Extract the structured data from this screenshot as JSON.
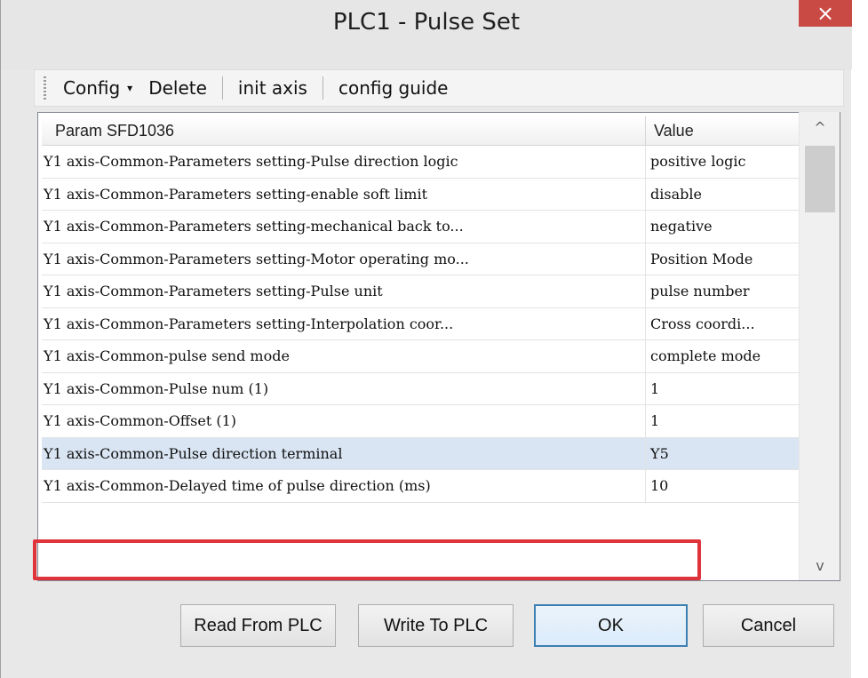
{
  "window": {
    "title": "PLC1 - Pulse  Set",
    "close_glyph": "×"
  },
  "toolbar": {
    "config_label": "Config",
    "config_caret": "▾",
    "delete_label": "Delete",
    "init_axis_label": "init axis",
    "config_guide_label": "config guide"
  },
  "grid": {
    "columns": [
      "Param SFD1036",
      "Value"
    ],
    "rows": [
      {
        "param": "Y1 axis-Common-Parameters setting-Pulse direction logic",
        "value": "positive logic"
      },
      {
        "param": "Y1 axis-Common-Parameters setting-enable soft limit",
        "value": "disable"
      },
      {
        "param": "Y1 axis-Common-Parameters setting-mechanical back to...",
        "value": "negative"
      },
      {
        "param": "Y1 axis-Common-Parameters setting-Motor operating mo...",
        "value": "Position Mode"
      },
      {
        "param": "Y1 axis-Common-Parameters setting-Pulse unit",
        "value": "pulse number"
      },
      {
        "param": "Y1 axis-Common-Parameters setting-Interpolation coor...",
        "value": "Cross coordi..."
      },
      {
        "param": "Y1 axis-Common-pulse send mode",
        "value": "complete mode"
      },
      {
        "param": "Y1 axis-Common-Pulse num (1)",
        "value": "1"
      },
      {
        "param": "Y1 axis-Common-Offset (1)",
        "value": "1"
      },
      {
        "param": "Y1 axis-Common-Pulse direction terminal",
        "value": "Y5"
      },
      {
        "param": "Y1 axis-Common-Delayed time of pulse direction (ms)",
        "value": "10"
      }
    ],
    "selected_row": 9
  },
  "scrollbar": {
    "up_glyph": "^",
    "down_glyph": "v"
  },
  "buttons": {
    "read": "Read From PLC",
    "write": "Write To PLC",
    "ok": "OK",
    "cancel": "Cancel"
  },
  "colors": {
    "close_button": "#c94a44",
    "selected_row": "#d9e5f3",
    "highlight_border": "#e0343c",
    "ok_border": "#3c7fb1"
  }
}
